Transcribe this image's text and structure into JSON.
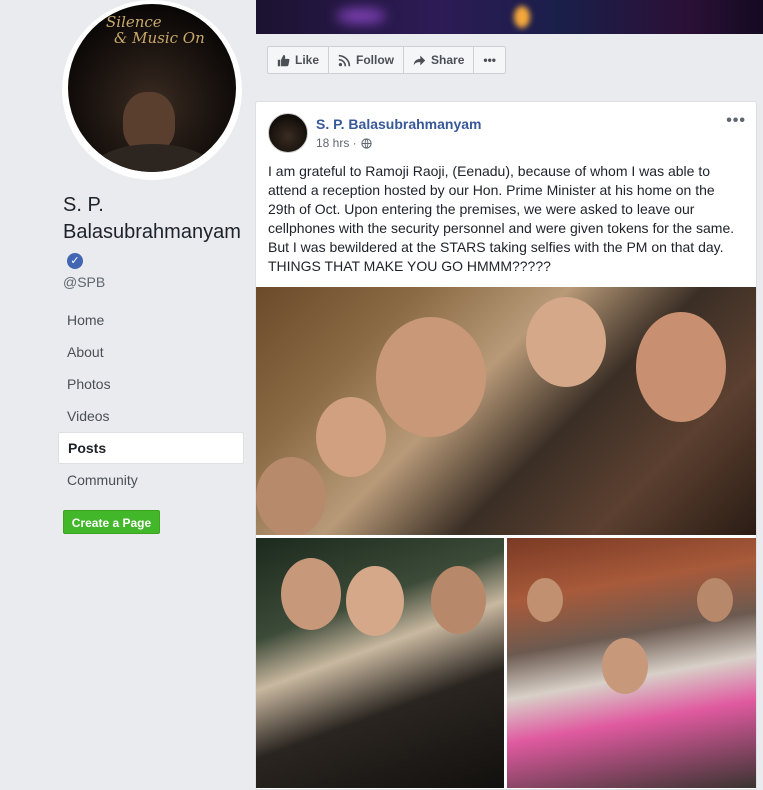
{
  "page": {
    "name": "S. P. Balasubrahmanyam",
    "handle": "@SPB",
    "avatar_text_line1": "Silence",
    "avatar_text_line2": "& Music On"
  },
  "nav": {
    "items": [
      {
        "label": "Home"
      },
      {
        "label": "About"
      },
      {
        "label": "Photos"
      },
      {
        "label": "Videos"
      },
      {
        "label": "Posts",
        "active": true
      },
      {
        "label": "Community"
      }
    ]
  },
  "create_page_label": "Create a Page",
  "actions": {
    "like": "Like",
    "follow": "Follow",
    "share": "Share",
    "more": "•••"
  },
  "post": {
    "author": "S. P. Balasubrahmanyam",
    "time": "18 hrs ·",
    "more": "•••",
    "text_lines": [
      "I am grateful to Ramoji Raoji, (Eenadu), because of whom I was able to",
      "attend a reception hosted by our Hon. Prime Minister at his home on the",
      "29th of Oct. Upon entering the premises, we were asked to leave our",
      "cellphones with the security personnel and were given tokens for the same.",
      "But I was bewildered at the STARS taking selfies with the PM on that day.",
      "THINGS THAT MAKE YOU GO HMMM?????"
    ]
  },
  "colors": {
    "link": "#385898",
    "create_button": "#42b72a",
    "verified": "#4267b2",
    "background": "#e9ebee"
  }
}
